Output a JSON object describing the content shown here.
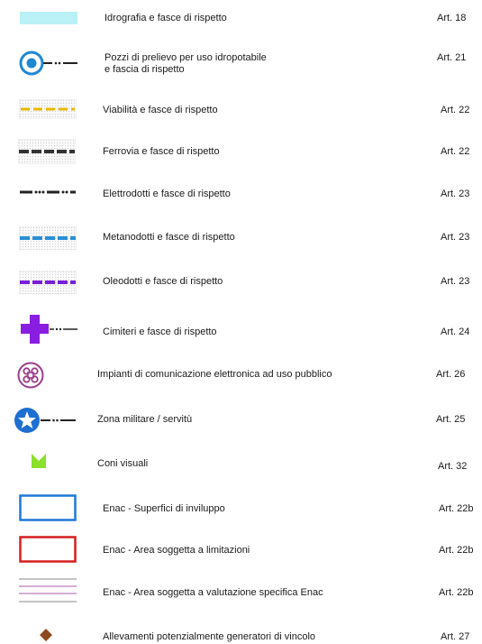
{
  "legend": {
    "rows": [
      {
        "label": "Idrografia e fasce di rispetto",
        "art": "Art. 18",
        "icon": "hydrography-band-icon"
      },
      {
        "label": "Pozzi di prelievo per uso idropotabile",
        "label2": "e fascia di rispetto",
        "art": "Art. 21",
        "icon": "water-well-icon"
      },
      {
        "label": "Viabilità e fasce di rispetto",
        "art": "Art. 22",
        "icon": "road-band-icon"
      },
      {
        "label": "Ferrovia e fasce di rispetto",
        "art": "Art. 22",
        "icon": "railway-band-icon"
      },
      {
        "label": "Elettrodotti e fasce di rispetto",
        "art": "Art. 23",
        "icon": "power-line-icon"
      },
      {
        "label": "Metanodotti e fasce di rispetto",
        "art": "Art. 23",
        "icon": "gas-pipeline-band-icon"
      },
      {
        "label": "Oleodotti e fasce di rispetto",
        "art": "Art. 23",
        "icon": "oil-pipeline-band-icon"
      },
      {
        "label": "Cimiteri e fasce di rispetto",
        "art": "Art. 24",
        "icon": "cemetery-cross-icon"
      },
      {
        "label": "Impianti di comunicazione elettronica ad uso pubblico",
        "art": "Art. 26",
        "icon": "communication-antenna-icon"
      },
      {
        "label": "Zona militare / servitù",
        "art": "Art. 25",
        "icon": "military-star-icon"
      },
      {
        "label": "Coni visuali",
        "art": "Art. 32",
        "icon": "view-cone-icon"
      },
      {
        "label": "Enac - Superfici di inviluppo",
        "art": "Art. 22b",
        "icon": "blue-rectangle-icon"
      },
      {
        "label": "Enac - Area soggetta a limitazioni",
        "art": "Art. 22b",
        "icon": "red-rectangle-icon"
      },
      {
        "label": "Enac - Area soggetta a valutazione specifica Enac",
        "art": "Art. 22b",
        "icon": "purple-lines-icon"
      },
      {
        "label": "Allevamenti potenzialmente generatori di vincolo",
        "art": "Art. 27",
        "icon": "brown-diamond-icon"
      }
    ]
  },
  "colors": {
    "hydro": "#b9f1f6",
    "well": "#1e88d4",
    "road": "#e8b800",
    "rail": "#333333",
    "gas": "#2a8fd6",
    "oil": "#7a1fd8",
    "cemetery": "#8a1ee0",
    "antenna": "#9c3c8c",
    "military": "#1f6fd0",
    "cone": "#8be02c",
    "enac_blue": "#1e78d8",
    "enac_red": "#d61e1e",
    "enac_purple": "#a85ca8",
    "farm": "#8b4a1e"
  }
}
